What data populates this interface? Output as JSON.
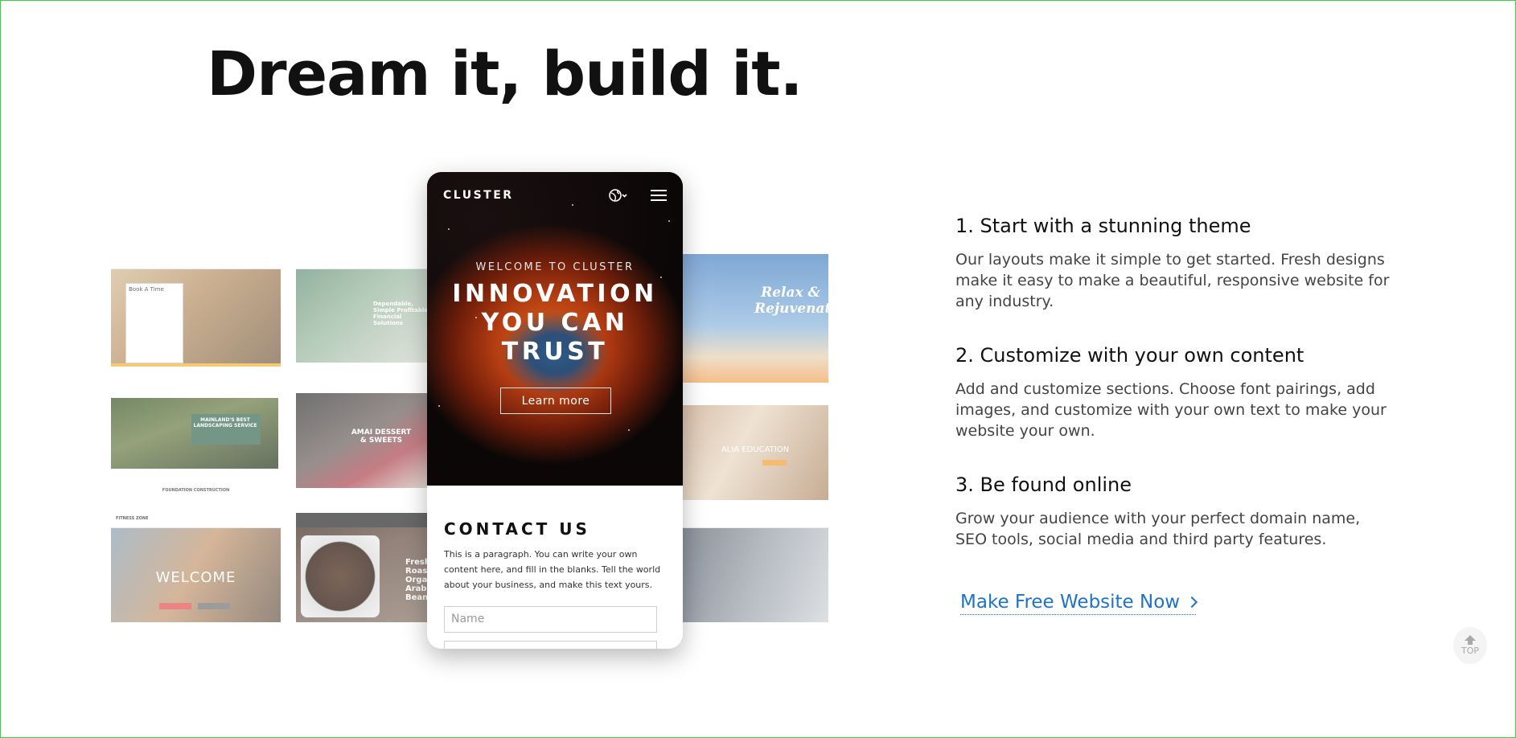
{
  "headline": "Dream it, build it.",
  "mosaic": {
    "tiles": [
      {
        "name": "book-a-time-theme",
        "text": "Book A Time"
      },
      {
        "name": "financial-theme",
        "text": "Dependable, Simple Profitable Financial Solutions"
      },
      {
        "name": "landscaping-theme",
        "text": "MAINLAND'S BEST LANDSCAPING SERVICE"
      },
      {
        "name": "landscaping-footer",
        "text": "FOUNDATION CONSTRUCTION"
      },
      {
        "name": "dessert-theme",
        "text": "AMAI DESSERT & SWEETS"
      },
      {
        "name": "fitness-theme",
        "text": "WELCOME"
      },
      {
        "name": "fitness-brand",
        "text": "FITNESS ZONE"
      },
      {
        "name": "coffee-theme",
        "text": "Fresh, Roast Organ Arabic Beans"
      },
      {
        "name": "spa-theme",
        "text": "Relax & Rejuvenate"
      },
      {
        "name": "education-theme",
        "text": "ALIA EDUCATION"
      }
    ]
  },
  "phone": {
    "logo": "CLUSTER",
    "welcome": "WELCOME TO CLUSTER",
    "title_lines": [
      "INNOVATION",
      "YOU CAN",
      "TRUST"
    ],
    "learn_more": "Learn more",
    "contact_heading": "CONTACT US",
    "contact_paragraph": "This is a paragraph. You can write your own content here, and fill in the blanks. Tell the world about your business, and make this text yours.",
    "name_placeholder": "Name"
  },
  "features": [
    {
      "title": "1. Start with a stunning theme",
      "desc": "Our layouts make it simple to get started. Fresh designs make it easy to make a beautiful, responsive website for any industry."
    },
    {
      "title": "2. Customize with your own content",
      "desc": "Add and customize sections. Choose font pairings, add images, and customize with your own text to make your website your own."
    },
    {
      "title": "3. Be found online",
      "desc": "Grow your audience with your perfect domain name, SEO tools, social media and third party features."
    }
  ],
  "cta": {
    "label": "Make Free Website Now",
    "color": "#1f73c7"
  },
  "top_button": {
    "label": "TOP"
  }
}
